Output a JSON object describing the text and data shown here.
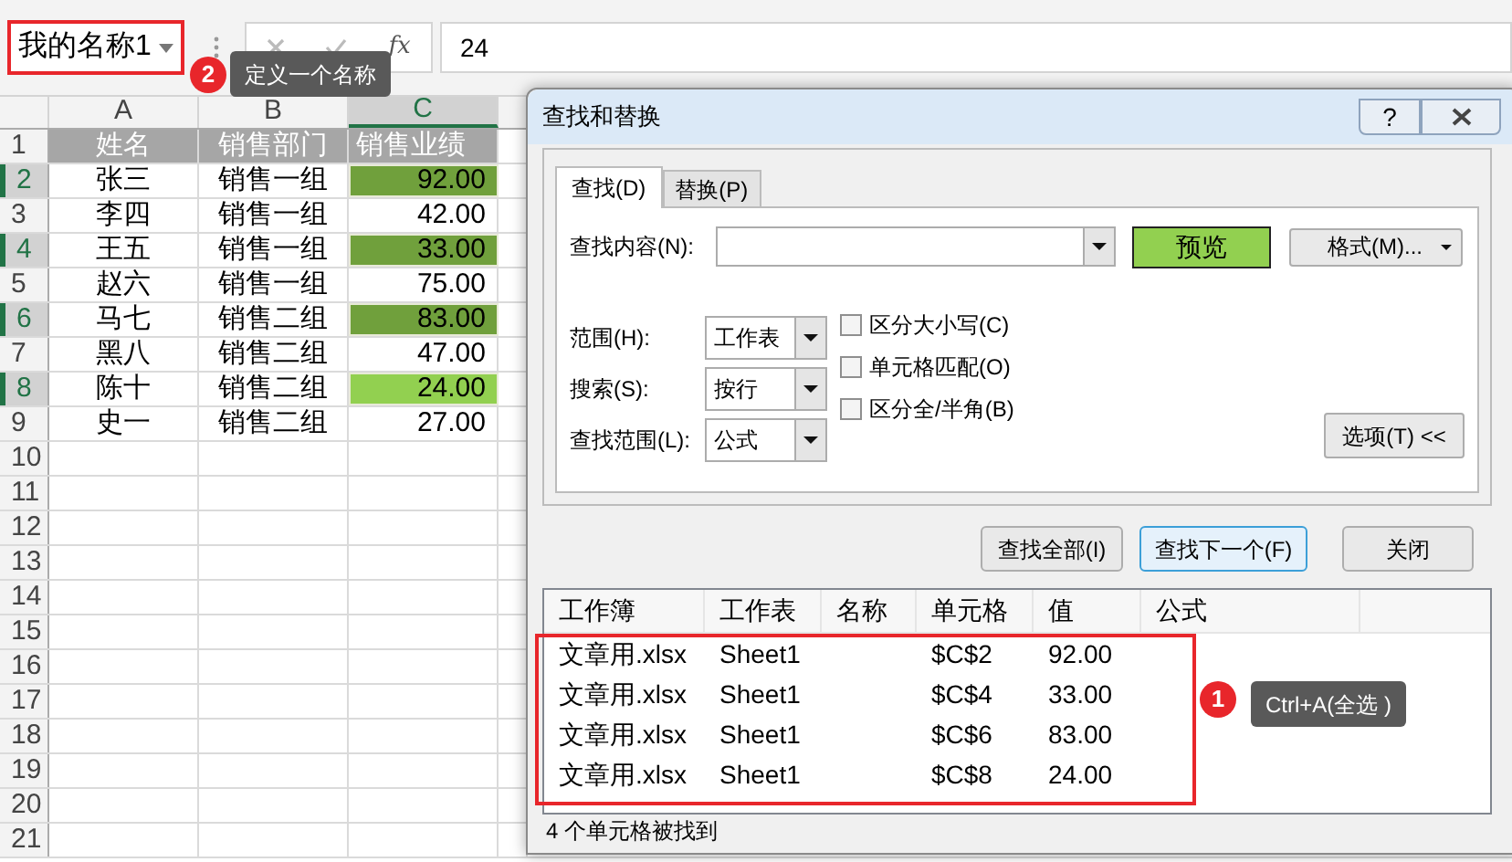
{
  "name_box": {
    "value": "我的名称1",
    "highlighted": true
  },
  "formula_bar": {
    "function_label": "fx",
    "value": "24"
  },
  "sheet": {
    "columns": [
      {
        "label": "A",
        "selected": false
      },
      {
        "label": "B",
        "selected": false
      },
      {
        "label": "C",
        "selected": true
      }
    ],
    "rows": [
      {
        "number": "1",
        "selected": false,
        "kind": "header",
        "cells": [
          "姓名",
          "销售部门",
          "销售业绩"
        ]
      },
      {
        "number": "2",
        "selected": true,
        "cells": [
          "张三",
          "销售一组",
          "92.00"
        ],
        "color": "#70a03c"
      },
      {
        "number": "3",
        "selected": false,
        "cells": [
          "李四",
          "销售一组",
          "42.00"
        ]
      },
      {
        "number": "4",
        "selected": true,
        "cells": [
          "王五",
          "销售一组",
          "33.00"
        ],
        "color": "#70a03c"
      },
      {
        "number": "5",
        "selected": false,
        "cells": [
          "赵六",
          "销售一组",
          "75.00"
        ]
      },
      {
        "number": "6",
        "selected": true,
        "cells": [
          "马七",
          "销售二组",
          "83.00"
        ],
        "color": "#70a03c"
      },
      {
        "number": "7",
        "selected": false,
        "cells": [
          "黑八",
          "销售二组",
          "47.00"
        ]
      },
      {
        "number": "8",
        "selected": true,
        "cells": [
          "陈十",
          "销售二组",
          "24.00"
        ],
        "color": "#92d050"
      },
      {
        "number": "9",
        "selected": false,
        "cells": [
          "史一",
          "销售二组",
          "27.00"
        ]
      },
      {
        "number": "10",
        "selected": false
      },
      {
        "number": "11",
        "selected": false
      },
      {
        "number": "12",
        "selected": false
      },
      {
        "number": "13",
        "selected": false
      },
      {
        "number": "14",
        "selected": false
      },
      {
        "number": "15",
        "selected": false
      },
      {
        "number": "16",
        "selected": false
      },
      {
        "number": "17",
        "selected": false
      },
      {
        "number": "18",
        "selected": false
      },
      {
        "number": "19",
        "selected": false
      },
      {
        "number": "20",
        "selected": false
      },
      {
        "number": "21",
        "selected": false
      }
    ]
  },
  "dialog": {
    "title": "查找和替换",
    "help": "?",
    "tabs": [
      {
        "label": "查找(D)",
        "selected": true
      },
      {
        "label": "替换(P)",
        "selected": false
      }
    ],
    "find_label": "查找内容(N):",
    "preview_button": "预览",
    "format_button": "格式(M)...",
    "selects": [
      {
        "label": "范围(H):",
        "value": "工作表"
      },
      {
        "label": "搜索(S):",
        "value": "按行"
      },
      {
        "label": "查找范围(L):",
        "value": "公式"
      }
    ],
    "checkboxes": [
      {
        "label": "区分大小写(C)",
        "checked": false
      },
      {
        "label": "单元格匹配(O)",
        "checked": false
      },
      {
        "label": "区分全/半角(B)",
        "checked": false
      }
    ],
    "options_button": "选项(T) <<",
    "buttons": [
      {
        "label": "查找全部(I)",
        "default": false
      },
      {
        "label": "查找下一个(F)",
        "default": true
      },
      {
        "label": "关闭",
        "default": false
      }
    ],
    "results": {
      "columns": [
        "工作簿",
        "工作表",
        "名称",
        "单元格",
        "值",
        "公式"
      ],
      "rows": [
        {
          "workbook": "文章用.xlsx",
          "sheet": "Sheet1",
          "cell": "$C$2",
          "value": "92.00"
        },
        {
          "workbook": "文章用.xlsx",
          "sheet": "Sheet1",
          "cell": "$C$4",
          "value": "33.00"
        },
        {
          "workbook": "文章用.xlsx",
          "sheet": "Sheet1",
          "cell": "$C$6",
          "value": "83.00"
        },
        {
          "workbook": "文章用.xlsx",
          "sheet": "Sheet1",
          "cell": "$C$8",
          "value": "24.00"
        }
      ],
      "highlighted": true
    },
    "status": "4 个单元格被找到"
  },
  "annotations": [
    {
      "number": "2",
      "text": "定义一个名称"
    },
    {
      "number": "1",
      "text": "Ctrl+A(全选 )"
    }
  ]
}
